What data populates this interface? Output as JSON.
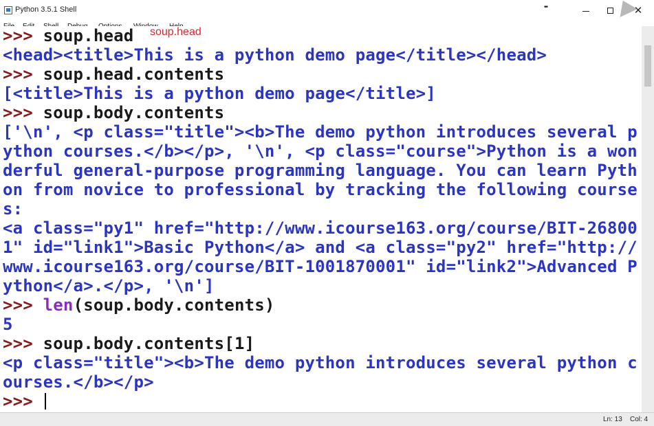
{
  "window": {
    "title": "Python 3.5.1 Shell",
    "restore_glyph": "••",
    "minimize_icon": "minimize-icon",
    "maximize_icon": "maximize-icon",
    "close_label": "✕"
  },
  "menu": [
    {
      "label": "File"
    },
    {
      "label": "Edit"
    },
    {
      "label": "Shell"
    },
    {
      "label": "Debug"
    },
    {
      "label": "Options"
    },
    {
      "label": "Window"
    },
    {
      "label": "Help"
    }
  ],
  "annotation": "soup.head",
  "shell": {
    "lines": [
      {
        "kind": "input",
        "prompt": ">>> ",
        "code": "soup.head"
      },
      {
        "kind": "output",
        "text": "<head><title>This is a python demo page</title></head>"
      },
      {
        "kind": "input",
        "prompt": ">>> ",
        "code": "soup.head.contents"
      },
      {
        "kind": "output",
        "text": "[<title>This is a python demo page</title>]"
      },
      {
        "kind": "input",
        "prompt": ">>> ",
        "code": "soup.body.contents"
      },
      {
        "kind": "output",
        "text": "['\\n', <p class=\"title\"><b>The demo python introduces several p"
      },
      {
        "kind": "output",
        "text": "ython courses.</b></p>, '\\n', <p class=\"course\">Python is a won"
      },
      {
        "kind": "output",
        "text": "derful general-purpose programming language. You can learn Pyth"
      },
      {
        "kind": "output",
        "text": "on from novice to professional by tracking the following course"
      },
      {
        "kind": "output",
        "text": "s:"
      },
      {
        "kind": "output",
        "text": "<a class=\"py1\" href=\"http://www.icourse163.org/course/BIT-26800"
      },
      {
        "kind": "output",
        "text": "1\" id=\"link1\">Basic Python</a> and <a class=\"py2\" href=\"http://"
      },
      {
        "kind": "output",
        "text": "www.icourse163.org/course/BIT-1001870001\" id=\"link2\">Advanced P"
      },
      {
        "kind": "output",
        "text": "ython</a>.</p>, '\\n']"
      },
      {
        "kind": "input_builtin",
        "prompt": ">>> ",
        "builtin": "len",
        "code": "(soup.body.contents)"
      },
      {
        "kind": "output",
        "text": "5"
      },
      {
        "kind": "input",
        "prompt": ">>> ",
        "code": "soup.body.contents[1]"
      },
      {
        "kind": "output",
        "text": "<p class=\"title\"><b>The demo python introduces several python c"
      },
      {
        "kind": "output",
        "text": "ourses.</b></p>"
      },
      {
        "kind": "prompt_only",
        "prompt": ">>> "
      }
    ]
  },
  "status": {
    "ln": "Ln: 13",
    "col": "Col: 4"
  },
  "colors": {
    "prompt": "#8b1a1a",
    "output": "#2b35c4",
    "code": "#1a1a1a",
    "builtin": "#8b2bc4",
    "annotation": "#e8212e"
  }
}
